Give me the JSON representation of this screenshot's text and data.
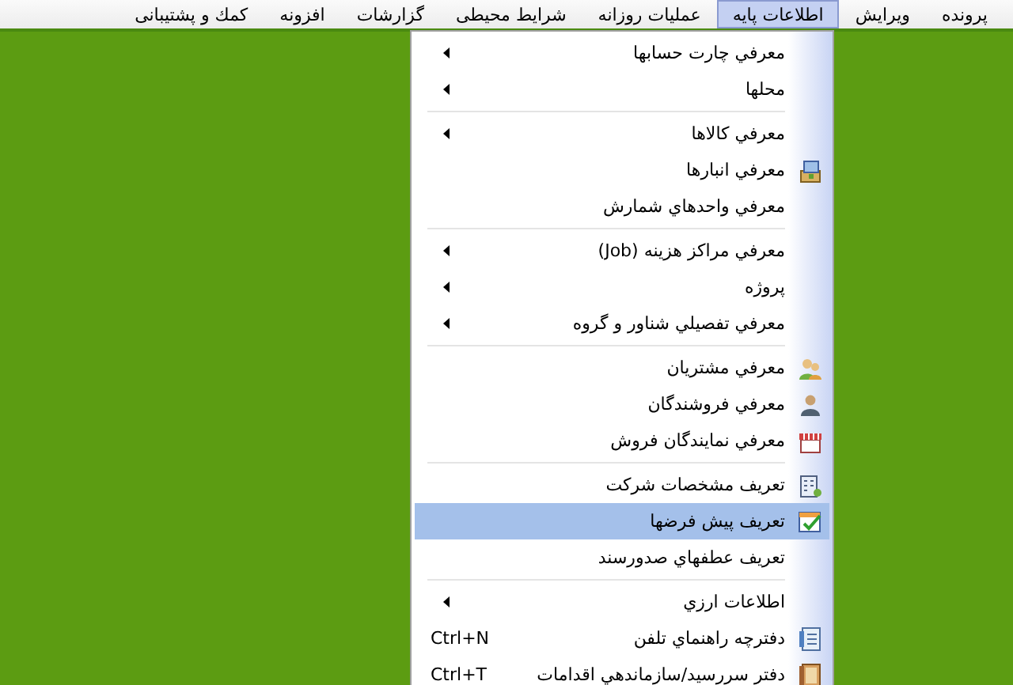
{
  "menubar": [
    {
      "label": "پرونده",
      "selected": false
    },
    {
      "label": "ویرایش",
      "selected": false
    },
    {
      "label": "اطلاعات پایه",
      "selected": true
    },
    {
      "label": "عملیات روزانه",
      "selected": false
    },
    {
      "label": "شرایط محیطی",
      "selected": false
    },
    {
      "label": "گزارشات",
      "selected": false
    },
    {
      "label": "افزونه",
      "selected": false
    },
    {
      "label": "کمك و پشتیبانی",
      "selected": false
    }
  ],
  "dropdown": {
    "groups": [
      [
        {
          "label": "معرفي چارت حسابها",
          "submenu": true,
          "selected": false
        },
        {
          "label": "محلها",
          "submenu": true,
          "selected": false
        }
      ],
      [
        {
          "label": "معرفي كالاها",
          "submenu": true,
          "selected": false
        },
        {
          "label": "معرفي انبارها",
          "kind": "warehouse",
          "submenu": false,
          "selected": false
        },
        {
          "label": "معرفي  واحدهاي شمارش",
          "submenu": false,
          "selected": false
        }
      ],
      [
        {
          "label": "معرفي مراكز هزينه (Job)",
          "submenu": true,
          "selected": false
        },
        {
          "label": "پروژه",
          "submenu": true,
          "selected": false
        },
        {
          "label": "معرفي تفصيلي شناور و گروه",
          "submenu": true,
          "selected": false
        }
      ],
      [
        {
          "label": "معرفي مشتريان",
          "kind": "people",
          "submenu": false,
          "selected": false
        },
        {
          "label": "معرفي فروشندگان",
          "kind": "person",
          "submenu": false,
          "selected": false
        },
        {
          "label": "معرفي نمايندگان فروش",
          "kind": "shop",
          "submenu": false,
          "selected": false
        }
      ],
      [
        {
          "label": "تعريف مشخصات شركت",
          "kind": "building",
          "submenu": false,
          "selected": false
        },
        {
          "label": "تعريف پيش فرضها",
          "kind": "check",
          "submenu": false,
          "selected": true
        },
        {
          "label": "تعريف عطفهاي صدورسند",
          "submenu": false,
          "selected": false
        }
      ],
      [
        {
          "label": "اطلاعات ارزي",
          "submenu": true,
          "selected": false
        },
        {
          "label": "دفترچه راهنماي تلفن",
          "kind": "phonebook",
          "shortcut": "Ctrl+N",
          "submenu": false,
          "selected": false
        },
        {
          "label": "دفتر سررسيد/سازماندهي اقدامات",
          "kind": "notebook",
          "shortcut": "Ctrl+T",
          "submenu": false,
          "selected": false
        }
      ]
    ]
  }
}
